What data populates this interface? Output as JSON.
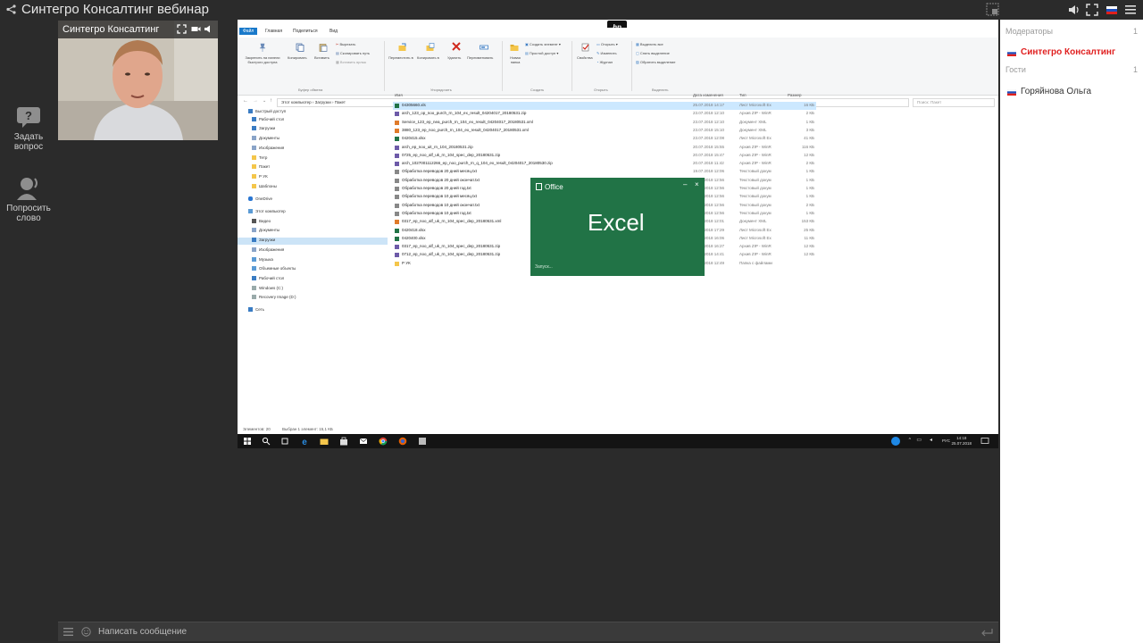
{
  "app": {
    "title": "Синтегро Консалтинг вебинар"
  },
  "sidebar": {
    "ask_question": "Задать вопрос",
    "request_floor": "Попросить слово"
  },
  "video": {
    "presenter_name": "Синтегро Консалтинг"
  },
  "chat": {
    "placeholder": "Написать сообщение"
  },
  "participants": {
    "moderators_label": "Модераторы",
    "moderators_count": "1",
    "moderators": [
      "Синтегро Консалтинг"
    ],
    "guests_label": "Гости",
    "guests_count": "1",
    "guests": [
      "Горяйнова Ольга"
    ],
    "moderator_color": "#e02020"
  },
  "screen": {
    "ribbon_tabs": [
      "Файл",
      "Главная",
      "Поделиться",
      "Вид"
    ],
    "ribbon_items": [
      "Закрепить на панели быстрого доступа",
      "Копировать",
      "Вставить",
      "Вырезать",
      "Скопировать путь",
      "Вставить ярлык",
      "Переместить в",
      "Копировать в",
      "Удалить",
      "Переименовать",
      "Новая папка",
      "Создать элемент",
      "Простой доступ",
      "Свойства",
      "Открыть",
      "Изменить",
      "Журнал",
      "Выделить все",
      "Снять выделение",
      "Обратить выделение"
    ],
    "ribbon_groups": [
      "Буфер обмена",
      "Упорядочить",
      "Создать",
      "Открыть",
      "Выделить"
    ],
    "address_path": "Этот компьютер  ›  Загрузки  ›  Пакет",
    "search_placeholder": "Поиск: Пакет",
    "nav_items": [
      "Быстрый доступ",
      "Рабочий стол",
      "Загрузки",
      "Документы",
      "Изображения",
      "Тетр",
      "Пакет",
      "Р УК",
      "Шаблоны",
      "OneDrive",
      "Этот компьютер",
      "Видео",
      "Документы",
      "Загрузки",
      "Изображения",
      "Музыка",
      "Объемные объекты",
      "Рабочий стол",
      "Windows (C:)",
      "Recovery Image (D:)",
      "Сеть"
    ],
    "columns": [
      "Имя",
      "Дата изменения",
      "Тип",
      "Размер"
    ],
    "files": [
      {
        "name": "04305660.xls",
        "date": "25.07.2018 14:17",
        "type": "Лист Microsoft Ex",
        "size": "16 КБ"
      },
      {
        "name": "arch_123_op_noo_purch_rn_104_ex_result_04204017_20180531.zip",
        "date": "23.07.2018 12:10",
        "type": "Архив ZIP - WinR",
        "size": "2 КБ"
      },
      {
        "name": "Service_123_ep_nea_purch_rn_104_ex_result_04204017_20180531.xml",
        "date": "23.07.2018 12:10",
        "type": "Документ XML",
        "size": "1 КБ"
      },
      {
        "name": "3880_123_ep_noo_purch_rn_104_ex_result_04204017_20180531.xml",
        "date": "23.07.2018 15:10",
        "type": "Документ XML",
        "size": "3 КБ"
      },
      {
        "name": "0420415.xlsx",
        "date": "23.07.2018 12:08",
        "type": "Лист Microsoft Ex",
        "size": "41 КБ"
      },
      {
        "name": "arch_ep_noo_uit_rn_104_20180531.zip",
        "date": "20.07.2018 15:55",
        "type": "Архив ZIP - WinR",
        "size": "116 КБ"
      },
      {
        "name": "0725_ep_noo_alf_uk_rn_104_spec_dep_20180531.zip",
        "date": "20.07.2018 15:47",
        "type": "Архив ZIP - WinR",
        "size": "12 КБ"
      },
      {
        "name": "arch_1027001112266_ep_noo_purch_rn_q_104_ex_result_04204017_20180530.zip",
        "date": "20.07.2018 11:42",
        "type": "Архив ZIP - WinR",
        "size": "2 КБ"
      },
      {
        "name": "Обработка переводов 20 дней месяц.txt",
        "date": "19.07.2018 12:06",
        "type": "Текстовый докум",
        "size": "1 КБ"
      },
      {
        "name": "Обработка переводов 20 дней окончат.txt",
        "date": "19.07.2018 12:56",
        "type": "Текстовый докум",
        "size": "1 КБ"
      },
      {
        "name": "Обработка переводов 20 дней год.txt",
        "date": "19.07.2018 12:56",
        "type": "Текстовый докум",
        "size": "1 КБ"
      },
      {
        "name": "Обработка переводов 10 дней месяц.txt",
        "date": "19.07.2018 12:56",
        "type": "Текстовый докум",
        "size": "1 КБ"
      },
      {
        "name": "Обработка переводов 10 дней окончат.txt",
        "date": "19.07.2018 12:56",
        "type": "Текстовый докум",
        "size": "2 КБ"
      },
      {
        "name": "Обработка переводов 10 дней год.txt",
        "date": "19.07.2018 12:56",
        "type": "Текстовый докум",
        "size": "1 КБ"
      },
      {
        "name": "0317_ep_noo_alf_uk_rn_104_spec_dep_20180531.xml",
        "date": "19.07.2018 12:01",
        "type": "Документ XML",
        "size": "153 КБ"
      },
      {
        "name": "0420418.xlsx",
        "date": "19.07.2018 17:29",
        "type": "Лист Microsoft Ex",
        "size": "25 КБ"
      },
      {
        "name": "0420400.xlsx",
        "date": "19.07.2018 16:06",
        "type": "Лист Microsoft Ex",
        "size": "11 КБ"
      },
      {
        "name": "0317_ep_noo_alf_uk_rn_104_spec_dep_20180531.zip",
        "date": "19.07.2018 16:27",
        "type": "Архив ZIP - WinR",
        "size": "12 КБ"
      },
      {
        "name": "0712_ep_noo_alf_uk_rn_104_spec_dep_20180531.zip",
        "date": "19.07.2018 14:41",
        "type": "Архив ZIP - WinR",
        "size": "12 КБ"
      },
      {
        "name": "Р УК",
        "date": "19.07.2018 12:49",
        "type": "Папка с файлами",
        "size": ""
      }
    ],
    "status_left": "Элементов: 20",
    "status_selected": "Выбран 1 элемент: 15,1 КБ",
    "splash_office": "Office",
    "splash_app": "Excel",
    "splash_loading": "Запуск...",
    "hp_logo": "hp",
    "clock_time": "14:18",
    "clock_date": "25.07.2018",
    "lang": "РУС"
  },
  "colors": {
    "excel_green": "#217346",
    "windows_blue": "#1979ca",
    "selection": "#cce8ff"
  }
}
